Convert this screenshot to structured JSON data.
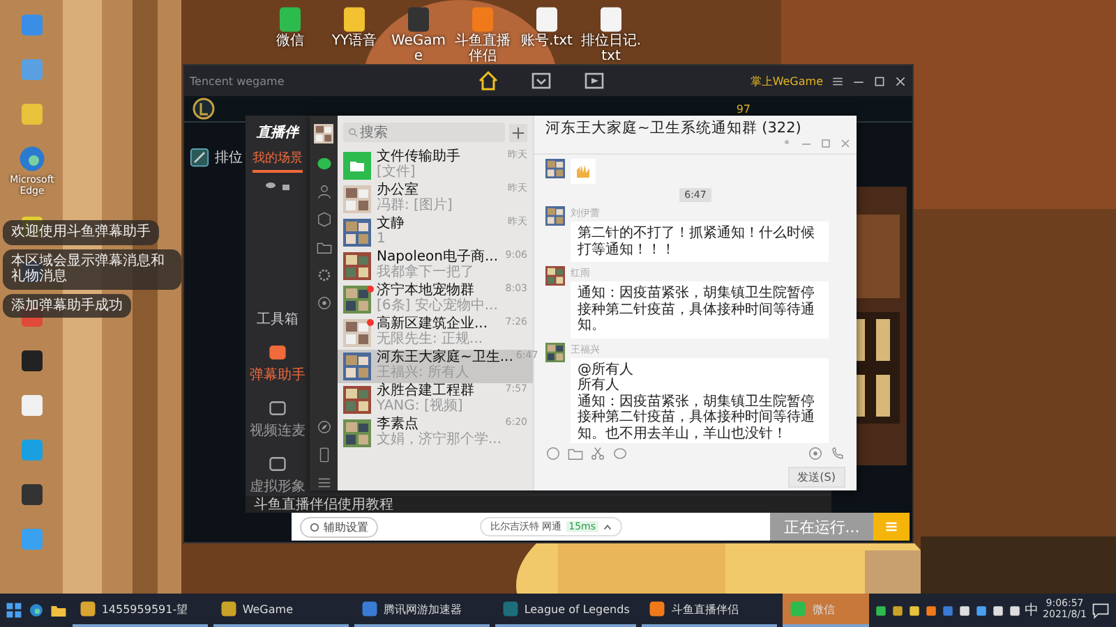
{
  "desktop": {
    "top_icons": [
      {
        "label": "微信",
        "color": "#2dbb4e"
      },
      {
        "label": "YY语音",
        "color": "#f2c230"
      },
      {
        "label": "WeGame",
        "color": "#333333"
      },
      {
        "label": "斗鱼直播伴侣",
        "color": "#f07a1a"
      },
      {
        "label": "账号.txt",
        "color": "#f4f4f4"
      },
      {
        "label": "排位日记.txt",
        "color": "#f4f4f4"
      }
    ],
    "edge_label": "Microsoft Edge"
  },
  "notifications": [
    "欢迎使用斗鱼弹幕助手",
    "本区域会显示弹幕消息和礼物消息",
    "添加弹幕助手成功"
  ],
  "wegame": {
    "title": "Tencent wegame",
    "mobile_link": "掌上WeGame",
    "nav": [
      {
        "kind": "home",
        "selected": true
      },
      {
        "kind": "store",
        "selected": false
      },
      {
        "kind": "video",
        "selected": false
      }
    ],
    "level": "97",
    "mode": "排位"
  },
  "douyu": {
    "logo": "直播伴",
    "tab": "我的场景",
    "toolbox": "工具箱",
    "tools": [
      {
        "label": "弹幕助手",
        "selected": true
      },
      {
        "label": "视频连麦",
        "selected": false
      },
      {
        "label": "虚拟形象",
        "selected": false
      }
    ],
    "tip": "斗鱼直播伴侣使用教程"
  },
  "wechat": {
    "search": {
      "placeholder": "搜索"
    },
    "chats": [
      {
        "kind": "file",
        "name": "文件传输助手",
        "preview": "[文件]",
        "time": "昨天",
        "unread": false,
        "selected": false
      },
      {
        "name": "办公室",
        "preview": "冯群: [图片]",
        "time": "昨天",
        "unread": false,
        "selected": false
      },
      {
        "name": "文静",
        "preview": "1",
        "time": "昨天",
        "unread": false,
        "selected": false
      },
      {
        "name": "Napoleon电子商...",
        "preview": "我都拿下一把了",
        "time": "9:06",
        "unread": false,
        "selected": false
      },
      {
        "name": "济宁本地宠物群",
        "preview": "[6条] 安心宠物中...",
        "time": "8:03",
        "unread": true,
        "selected": false
      },
      {
        "name": "高新区建筑企业...",
        "preview": "无限先生: 正规...",
        "time": "7:26",
        "unread": true,
        "selected": false
      },
      {
        "name": "河东王大家庭~卫生...",
        "preview": "王福兴: 所有人",
        "time": "6:47",
        "unread": false,
        "selected": true
      },
      {
        "name": "永胜合建工程群",
        "preview": "YANG: [视频]",
        "time": "7:57",
        "unread": false,
        "selected": false
      },
      {
        "name": "李素点",
        "preview": "文娟，济宁那个学...",
        "time": "6:20",
        "unread": false,
        "selected": false
      }
    ],
    "title": "河东王大家庭~卫生系统通知群 (322)",
    "messages": [
      {
        "kind": "sticker"
      },
      {
        "kind": "time",
        "text": "6:47"
      },
      {
        "kind": "text",
        "sender": "刘伊蕾",
        "lines": [
          "第二针的不打了！抓紧通知！什么时候打等通知！！！"
        ]
      },
      {
        "kind": "text",
        "sender": "红雨",
        "lines": [
          "通知：因疫苗紧张，胡集镇卫生院暂停接种第二针疫苗，具体接种时间等待通知。"
        ]
      },
      {
        "kind": "text",
        "sender": "王福兴",
        "lines": [
          "@所有人",
          "所有人",
          "通知：因疫苗紧张，胡集镇卫生院暂停接种第二针疫苗，具体接种时间等待通知。也不用去羊山，羊山也没针！"
        ]
      }
    ],
    "send": "发送(S)"
  },
  "stream_bar": {
    "settings": "辅助设置",
    "server": "比尔吉沃特 网通",
    "ping": "15ms",
    "status": "正在运行..."
  },
  "taskbar": {
    "apps": [
      {
        "label": "1455959591-望",
        "color": "#d9a431",
        "selected": false
      },
      {
        "label": "WeGame",
        "color": "#c9a227",
        "selected": false
      },
      {
        "label": "腾讯网游加速器",
        "color": "#3a7bd5",
        "selected": false
      },
      {
        "label": "League of Legends",
        "color": "#1c6f7a",
        "selected": false
      },
      {
        "label": "斗鱼直播伴侣",
        "color": "#f07a1a",
        "selected": false
      },
      {
        "label": "微信",
        "color": "#2dbb4e",
        "selected": true
      }
    ],
    "ime": "中",
    "time": "9:06:57",
    "date": "2021/8/1"
  }
}
